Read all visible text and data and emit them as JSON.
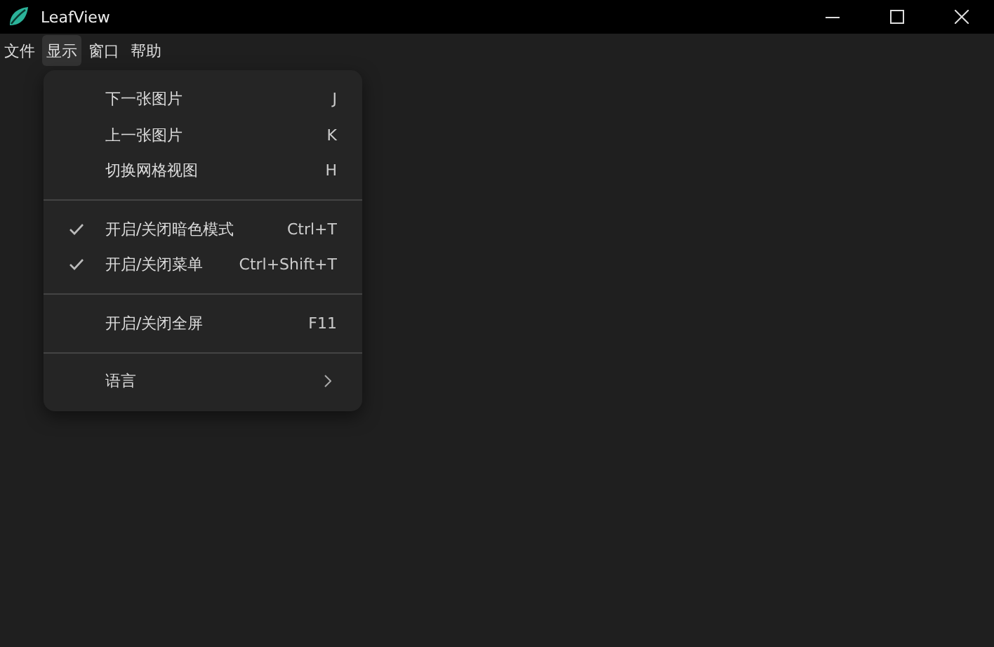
{
  "window": {
    "title": "LeafView"
  },
  "menu_bar": [
    {
      "label": "文件",
      "selected": false
    },
    {
      "label": "显示",
      "selected": true
    },
    {
      "label": "窗口",
      "selected": false
    },
    {
      "label": "帮助",
      "selected": false
    }
  ],
  "dropdown": {
    "groups": [
      {
        "items": [
          {
            "kind": "item",
            "label": "下一张图片",
            "shortcut": "J",
            "checked": false
          },
          {
            "kind": "item",
            "label": "上一张图片",
            "shortcut": "K",
            "checked": false
          },
          {
            "kind": "item",
            "label": "切换网格视图",
            "shortcut": "H",
            "checked": false
          }
        ]
      },
      {
        "items": [
          {
            "kind": "item",
            "label": "开启/关闭暗色模式",
            "shortcut": "Ctrl+T",
            "checked": true
          },
          {
            "kind": "item",
            "label": "开启/关闭菜单",
            "shortcut": "Ctrl+Shift+T",
            "checked": true
          }
        ]
      },
      {
        "items": [
          {
            "kind": "item",
            "label": "开启/关闭全屏",
            "shortcut": "F11",
            "checked": false
          }
        ]
      },
      {
        "items": [
          {
            "kind": "submenu",
            "label": "语言",
            "checked": false
          }
        ]
      }
    ]
  }
}
